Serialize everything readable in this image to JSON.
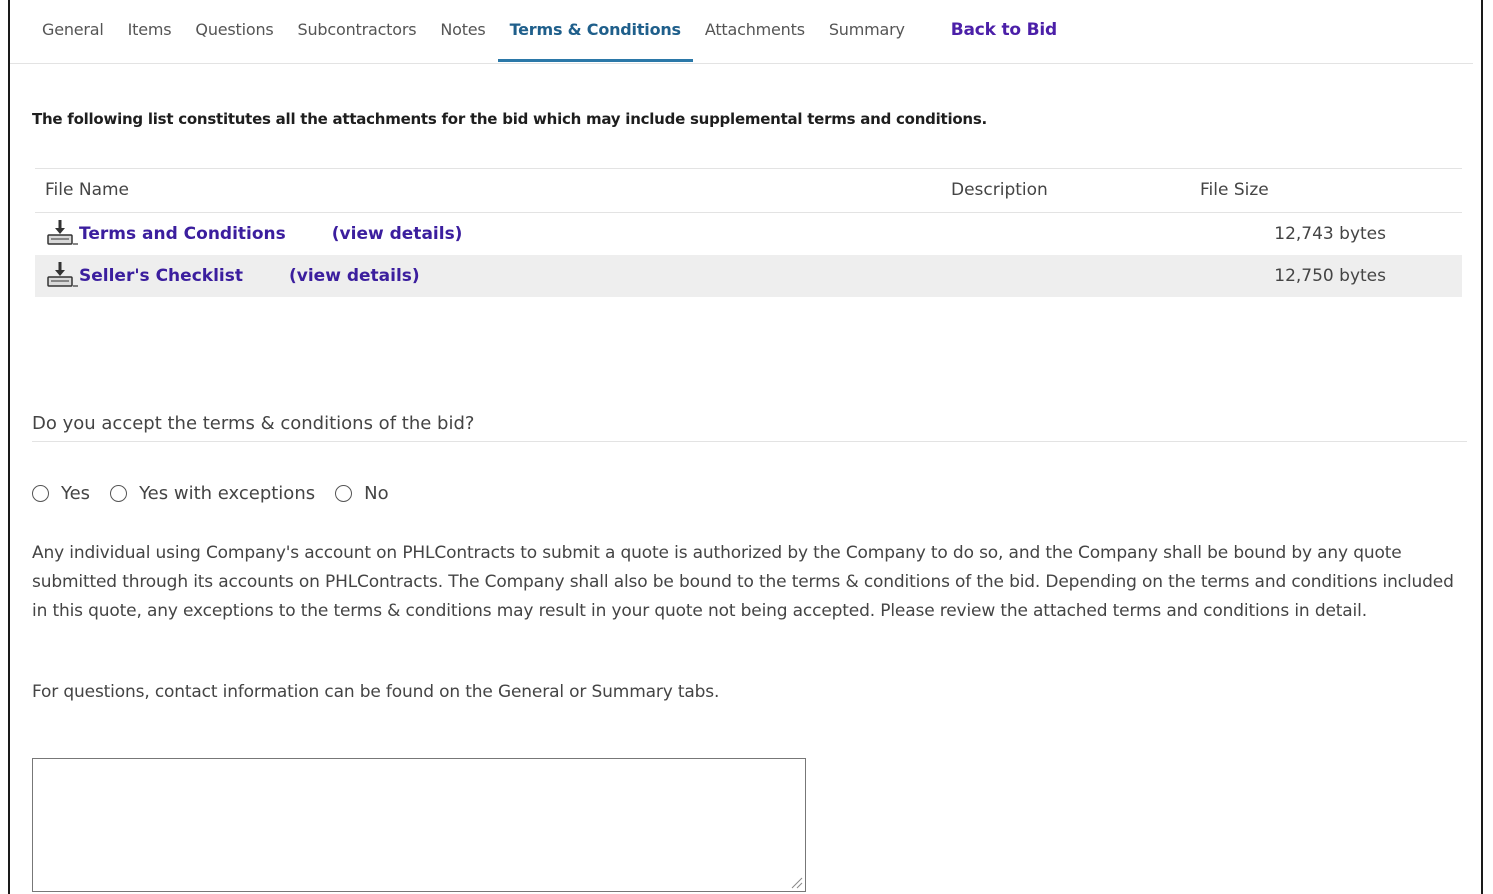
{
  "tabs": [
    {
      "label": "General"
    },
    {
      "label": "Items"
    },
    {
      "label": "Questions"
    },
    {
      "label": "Subcontractors"
    },
    {
      "label": "Notes"
    },
    {
      "label": "Terms & Conditions",
      "active": true
    },
    {
      "label": "Attachments"
    },
    {
      "label": "Summary"
    }
  ],
  "back_link": "Back to Bid",
  "intro": "The following list constitutes all the attachments for the bid which may include supplemental terms and conditions.",
  "attachments": {
    "headers": {
      "file_name": "File Name",
      "description": "Description",
      "file_size": "File Size"
    },
    "rows": [
      {
        "name": "Terms and Conditions",
        "details": "(view details)",
        "description": "",
        "size": "12,743 bytes"
      },
      {
        "name": "Seller's Checklist",
        "details": "(view details)",
        "description": "",
        "size": "12,750 bytes"
      }
    ]
  },
  "question": "Do you accept the terms & conditions of the bid?",
  "options": [
    "Yes",
    "Yes with exceptions",
    "No"
  ],
  "disclaimer": "Any individual using Company's account on PHLContracts to submit a quote is authorized by the Company to do so, and the Company shall be bound by any quote submitted through its accounts on PHLContracts. The Company shall also be bound to the terms & conditions of the bid. Depending on the terms and conditions included in this quote, any exceptions to the terms & conditions may result in your quote not being accepted. Please review the attached terms and conditions in detail.",
  "contact_note": "For questions, contact information can be found on the General or Summary tabs.",
  "comment_value": "",
  "colors": {
    "accent": "#2b78a8",
    "link": "#3b1e9e",
    "alt_row": "#eeeeee"
  }
}
